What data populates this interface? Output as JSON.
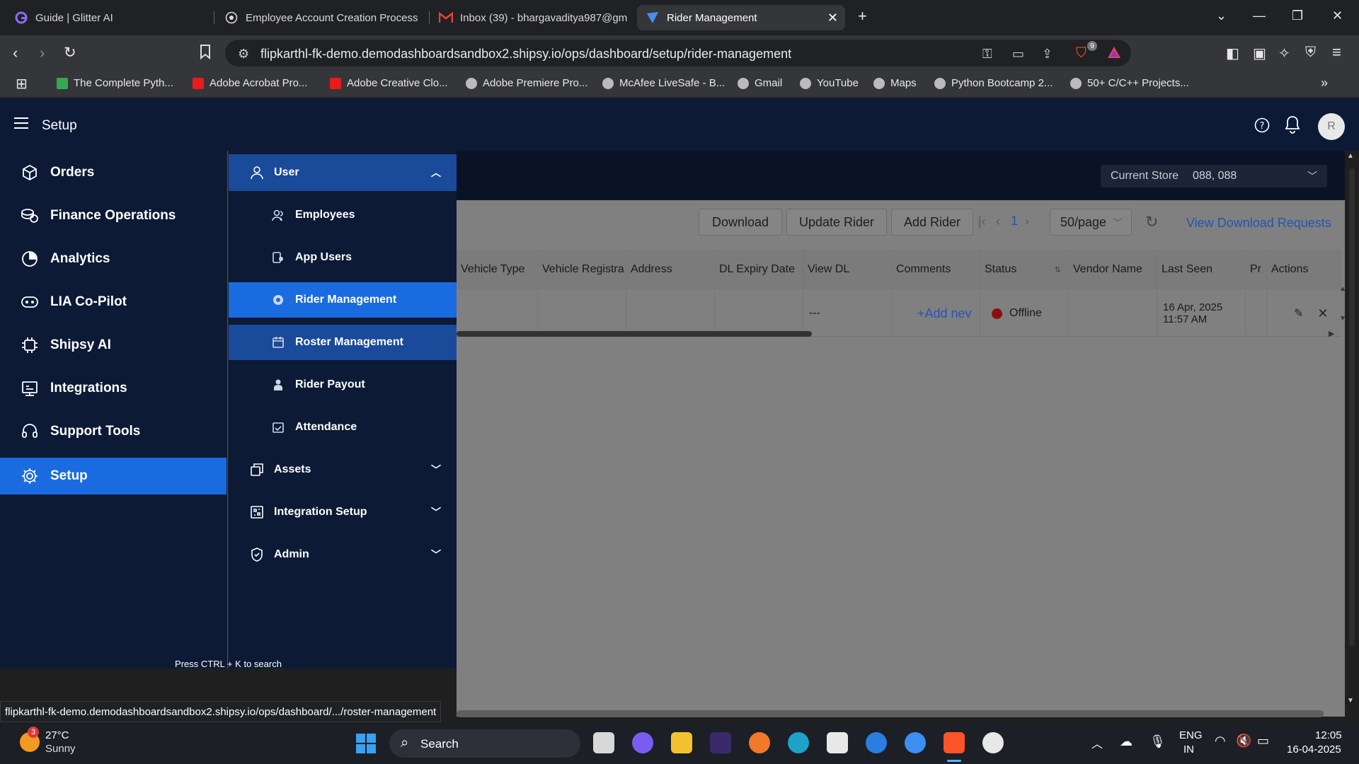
{
  "browser": {
    "tabs": [
      {
        "title": "Guide | Glitter AI"
      },
      {
        "title": "Employee Account Creation Process"
      },
      {
        "title": "Inbox (39) - bhargavaditya987@gm"
      },
      {
        "title": "Rider Management"
      }
    ],
    "url": "flipkarthl-fk-demo.demodashboardsandbox2.shipsy.io/ops/dashboard/setup/rider-management",
    "shield_badge": "9",
    "bookmarks": [
      "The Complete Pyth...",
      "Adobe Acrobat Pro...",
      "Adobe Creative Clo...",
      "Adobe Premiere Pro...",
      "McAfee LiveSafe - B...",
      "Gmail",
      "YouTube",
      "Maps",
      "Python Bootcamp 2...",
      "50+ C/C++ Projects..."
    ],
    "status_url": "flipkarthl-fk-demo.demodashboardsandbox2.shipsy.io/ops/dashboard/.../roster-management"
  },
  "header": {
    "title": "Setup",
    "avatar_initial": "R"
  },
  "sidebar": {
    "items": [
      {
        "label": "Orders",
        "icon": "package-icon"
      },
      {
        "label": "Finance Operations",
        "icon": "coins-icon"
      },
      {
        "label": "Analytics",
        "icon": "pie-chart-icon"
      },
      {
        "label": "LIA Co-Pilot",
        "icon": "copilot-icon"
      },
      {
        "label": "Shipsy AI",
        "icon": "ai-chip-icon"
      },
      {
        "label": "Integrations",
        "icon": "integrations-icon"
      },
      {
        "label": "Support Tools",
        "icon": "headset-icon"
      },
      {
        "label": "Setup",
        "icon": "gear-icon",
        "active": true
      }
    ]
  },
  "submenu": {
    "user_label": "User",
    "children": [
      {
        "label": "Employees"
      },
      {
        "label": "App Users"
      },
      {
        "label": "Rider Management"
      },
      {
        "label": "Roster Management"
      },
      {
        "label": "Rider Payout"
      },
      {
        "label": "Attendance"
      }
    ],
    "groups": [
      {
        "label": "Assets"
      },
      {
        "label": "Integration Setup"
      },
      {
        "label": "Admin"
      }
    ],
    "search_hint": "Press CTRL + K to search"
  },
  "store": {
    "label": "Current Store",
    "value": "088, 088"
  },
  "toolbar": {
    "download": "Download",
    "update_rider": "Update Rider",
    "add_rider": "Add Rider",
    "page": "1",
    "per_page": "50/page",
    "view_downloads": "View Download Requests"
  },
  "table": {
    "headers": [
      "Vehicle Type",
      "Vehicle Registra",
      "Address",
      "DL Expiry Date",
      "View DL",
      "Comments",
      "Status",
      "Vendor Name",
      "Last Seen",
      "Pr",
      "Actions"
    ],
    "row": {
      "view_dl": "---",
      "comments": "+Add nev",
      "status": "Offline",
      "last_seen_date": "16 Apr, 2025",
      "last_seen_time": "11:57 AM"
    }
  },
  "taskbar": {
    "weather_badge": "3",
    "temperature": "27°C",
    "weather": "Sunny",
    "search": "Search",
    "lang_top": "ENG",
    "lang_bottom": "IN",
    "time": "12:05",
    "date": "16-04-2025"
  },
  "colors": {
    "app_navy": "#0c1a36",
    "accent_blue": "#1a6be0",
    "status_offline": "#8a1010"
  }
}
